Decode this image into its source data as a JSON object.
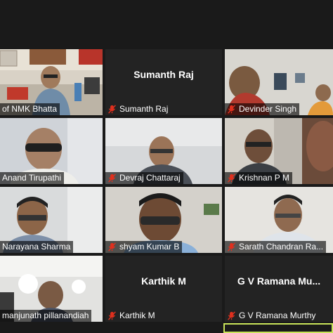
{
  "meeting": {
    "participants": [
      {
        "name": "of NMK Bhatta",
        "video": true,
        "muted": false
      },
      {
        "name": "Sumanth Raj",
        "video": false,
        "muted": true,
        "display_name": "Sumanth Raj"
      },
      {
        "name": "Devinder Singh",
        "video": true,
        "muted": true
      },
      {
        "name": "Anand Tirupathi",
        "video": true,
        "muted": false
      },
      {
        "name": "Devraj Chattaraj",
        "video": true,
        "muted": true
      },
      {
        "name": "Krishnan P M",
        "video": true,
        "muted": true
      },
      {
        "name": "Narayana Sharma",
        "video": true,
        "muted": false
      },
      {
        "name": "shyam Kumar B",
        "video": true,
        "muted": true
      },
      {
        "name": "Sarath Chandran Ra...",
        "video": true,
        "muted": true
      },
      {
        "name": "manjunath pillanandiah",
        "video": true,
        "muted": false
      },
      {
        "name": "Karthik M",
        "video": false,
        "muted": true,
        "display_name": "Karthik M"
      },
      {
        "name": "G V Ramana Murthy",
        "video": false,
        "muted": true,
        "display_name": "G V Ramana Mu..."
      }
    ],
    "colors": {
      "background": "#1a1a1a",
      "tile": "#2b2b2b",
      "muted_icon": "#e0301e",
      "active_speaker": "#c9e45a"
    },
    "icons": {
      "muted": "mic-muted-icon"
    }
  }
}
